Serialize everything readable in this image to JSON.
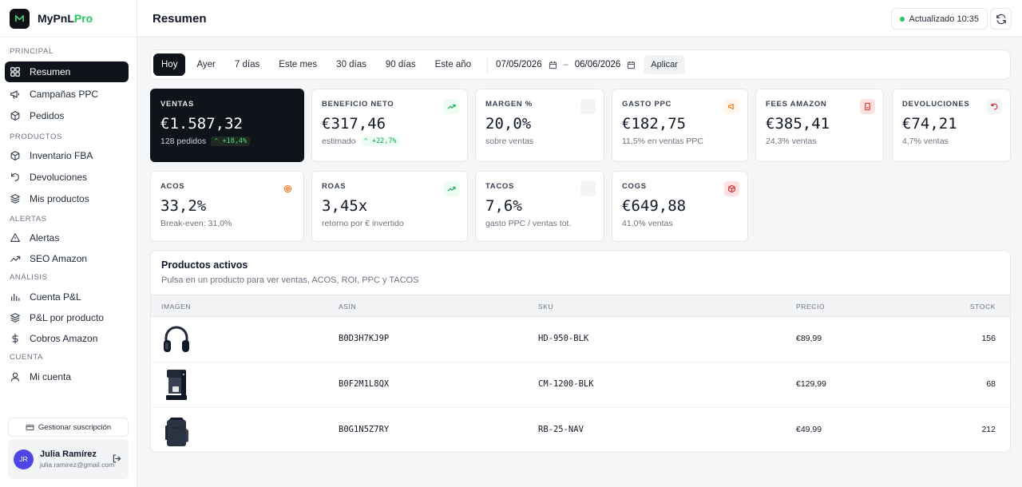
{
  "app": {
    "name_main": "MyPnL",
    "name_accent": "Pro"
  },
  "sidebar": {
    "sections": [
      {
        "title": "PRINCIPAL",
        "items": [
          {
            "label": "Resumen",
            "icon": "grid-icon",
            "active": true
          },
          {
            "label": "Campañas PPC",
            "icon": "megaphone-icon"
          },
          {
            "label": "Pedidos",
            "icon": "box-icon"
          }
        ]
      },
      {
        "title": "PRODUCTOS",
        "items": [
          {
            "label": "Inventario FBA",
            "icon": "package-icon"
          },
          {
            "label": "Devoluciones",
            "icon": "undo-icon"
          },
          {
            "label": "Mis productos",
            "icon": "layers-icon"
          }
        ]
      },
      {
        "title": "ALERTAS",
        "items": [
          {
            "label": "Alertas",
            "icon": "warning-icon"
          },
          {
            "label": "SEO Amazon",
            "icon": "trending-icon"
          }
        ]
      },
      {
        "title": "ANÁLISIS",
        "items": [
          {
            "label": "Cuenta P&L",
            "icon": "bar-chart-icon"
          },
          {
            "label": "P&L por producto",
            "icon": "layers-icon"
          },
          {
            "label": "Cobros Amazon",
            "icon": "dollar-icon"
          }
        ]
      },
      {
        "title": "CUENTA",
        "items": [
          {
            "label": "Mi cuenta",
            "icon": "user-icon"
          }
        ]
      }
    ],
    "manage_label": "Gestionar suscripción",
    "user": {
      "initials": "JR",
      "name": "Julia Ramírez",
      "email": "julia.ramirez@gmail.com"
    }
  },
  "header": {
    "title": "Resumen",
    "updated": "Actualizado 10:35"
  },
  "datebar": {
    "ranges": [
      "Hoy",
      "Ayer",
      "7 días",
      "Este mes",
      "30 días",
      "90 días",
      "Este año"
    ],
    "active_range": "Hoy",
    "date_from": "07/05/2026",
    "date_to": "06/06/2026",
    "separator": "–",
    "apply": "Aplicar"
  },
  "kpis": {
    "ventas": {
      "label": "VENTAS",
      "value": "€1.587,32",
      "sub": "128 pedidos",
      "delta": "⌃ +18,4%"
    },
    "beneficio": {
      "label": "BENEFICIO NETO",
      "value": "€317,46",
      "sub": "estimado",
      "delta": "⌃ +22,7%"
    },
    "margen": {
      "label": "MARGEN %",
      "value": "20,0%",
      "sub": "sobre ventas"
    },
    "gasto_ppc": {
      "label": "GASTO PPC",
      "value": "€182,75",
      "sub": "11,5% en ventas PPC"
    },
    "fees": {
      "label": "FEES AMAZON",
      "value": "€385,41",
      "sub": "24,3% ventas"
    },
    "devoluciones": {
      "label": "DEVOLUCIONES",
      "value": "€74,21",
      "sub": "4,7% ventas"
    },
    "acos": {
      "label": "ACOS",
      "value": "33,2%",
      "sub": "Break-even: 31,0%"
    },
    "roas": {
      "label": "ROAS",
      "value": "3,45x",
      "sub": "retorno por € invertido"
    },
    "tacos": {
      "label": "TACOS",
      "value": "7,6%",
      "sub": "gasto PPC / ventas tot."
    },
    "cogs": {
      "label": "COGS",
      "value": "€649,88",
      "sub": "41,0% ventas"
    }
  },
  "products": {
    "title": "Productos activos",
    "subtitle": "Pulsa en un producto para ver ventas, ACOS, ROI, PPC y TACOS",
    "columns": [
      "IMAGEN",
      "ASIN",
      "SKU",
      "PRECIO",
      "STOCK"
    ],
    "rows": [
      {
        "image": "headphones",
        "asin": "B0D3H7KJ9P",
        "sku": "HD-950-BLK",
        "price": "€89,99",
        "stock": "156"
      },
      {
        "image": "coffee-machine",
        "asin": "B0F2M1L8QX",
        "sku": "CM-1200-BLK",
        "price": "€129,99",
        "stock": "68"
      },
      {
        "image": "backpack",
        "asin": "B0G1N5Z7RY",
        "sku": "RB-25-NAV",
        "price": "€49,99",
        "stock": "212"
      }
    ]
  },
  "colors": {
    "accent_green": "#22c55e",
    "dark": "#0f141b",
    "orange": "#f97316",
    "red": "#dc2626"
  }
}
